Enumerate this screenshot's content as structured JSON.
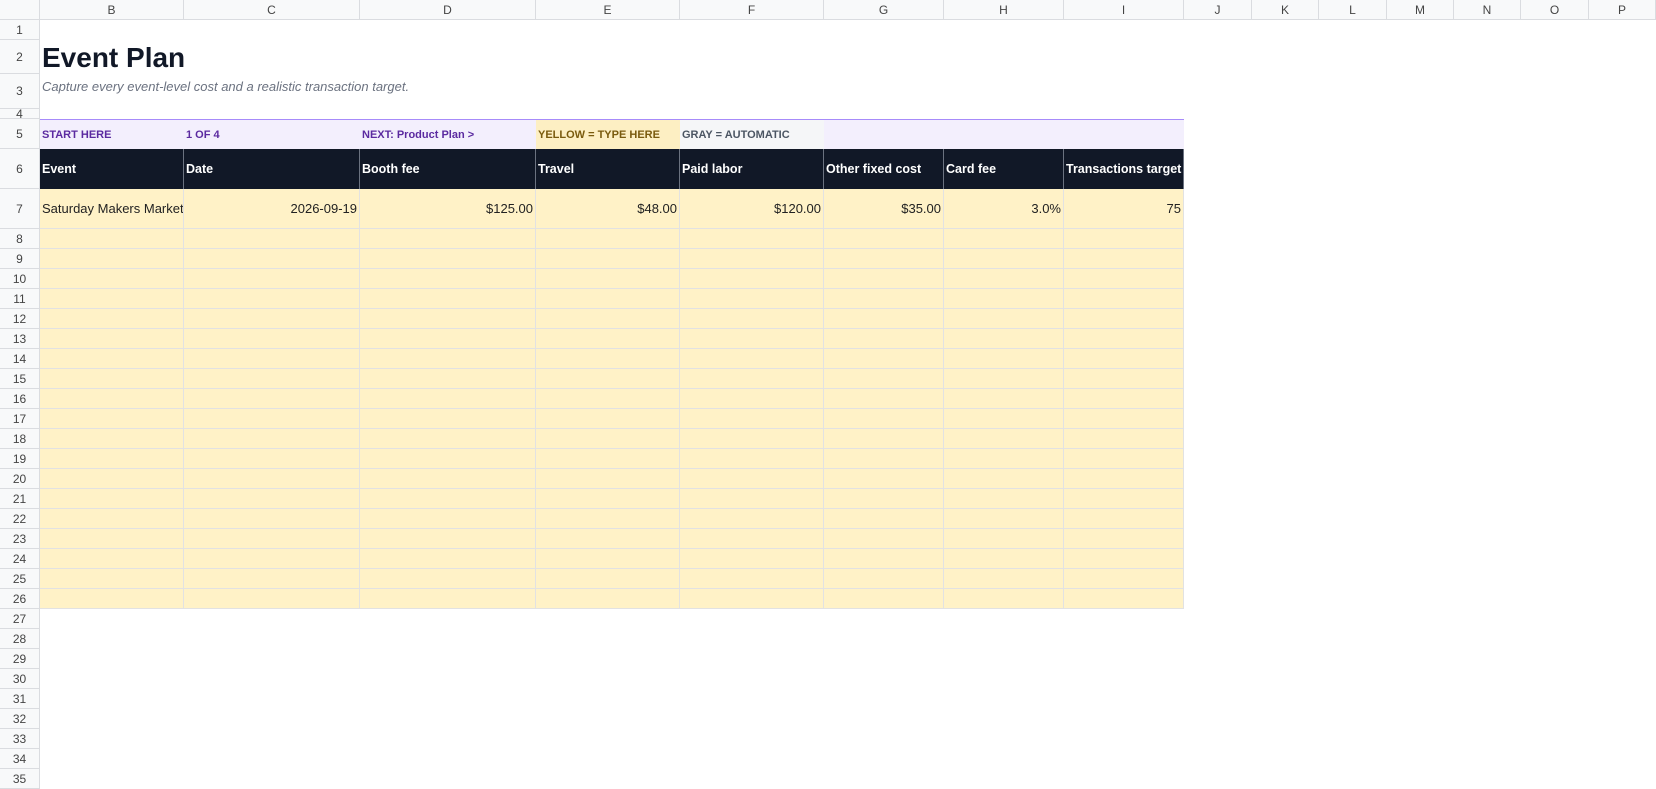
{
  "columns": [
    "B",
    "C",
    "D",
    "E",
    "F",
    "G",
    "H",
    "I",
    "J",
    "K",
    "L",
    "M",
    "N",
    "O",
    "P"
  ],
  "rows": [
    1,
    2,
    3,
    4,
    5,
    6,
    7,
    8,
    9,
    10,
    11,
    12,
    13,
    14,
    15,
    16,
    17,
    18,
    19,
    20,
    21,
    22,
    23,
    24,
    25,
    26,
    27,
    28,
    29,
    30,
    31,
    32,
    33,
    34,
    35
  ],
  "title": "Event Plan",
  "subtitle": "Capture every event-level cost and a realistic transaction target.",
  "banner": {
    "start": "START HERE",
    "step": "1 OF 4",
    "next": "NEXT: Product Plan  >",
    "legend_input": "YELLOW = TYPE HERE",
    "legend_auto": "GRAY = AUTOMATIC"
  },
  "headers": [
    "Event",
    "Date",
    "Booth fee",
    "Travel",
    "Paid labor",
    "Other fixed cost",
    "Card fee",
    "Transactions target"
  ],
  "data_rows": [
    [
      "Saturday Makers Market",
      "2026-09-19",
      "$125.00",
      "$48.00",
      "$120.00",
      "$35.00",
      "3.0%",
      "75"
    ]
  ],
  "colors": {
    "input_fill": "#fff2c7",
    "header_fill": "#111827",
    "banner_fill": "#f3effd",
    "banner_text": "#5b2aa0",
    "legend_input_fill": "#fdefc3",
    "legend_auto_fill": "#f5f6f8"
  }
}
